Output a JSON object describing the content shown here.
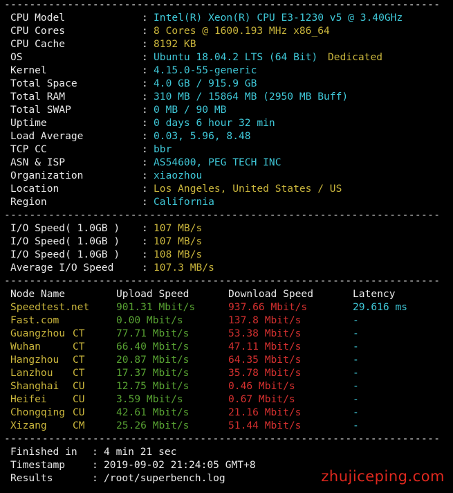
{
  "separator": "--------------------------------------------------------------------------",
  "system": [
    {
      "label": "CPU Model",
      "value": "Intel(R) Xeon(R) CPU E3-1230 v5 @ 3.40GHz",
      "extra": ""
    },
    {
      "label": "CPU Cores",
      "value": "8 Cores @ 1600.193 MHz x86_64",
      "extra": ""
    },
    {
      "label": "CPU Cache",
      "value": "8192 KB",
      "extra": ""
    },
    {
      "label": "OS",
      "value": "Ubuntu 18.04.2 LTS (64 Bit)",
      "extra": "Dedicated"
    },
    {
      "label": "Kernel",
      "value": "4.15.0-55-generic",
      "extra": ""
    },
    {
      "label": "Total Space",
      "value": "4.0 GB / 915.9 GB",
      "extra": ""
    },
    {
      "label": "Total RAM",
      "value": "310 MB / 15864 MB (2950 MB Buff)",
      "extra": ""
    },
    {
      "label": "Total SWAP",
      "value": "0 MB / 90 MB",
      "extra": ""
    },
    {
      "label": "Uptime",
      "value": "0 days 6 hour 32 min",
      "extra": ""
    },
    {
      "label": "Load Average",
      "value": "0.03, 5.96, 8.48",
      "extra": ""
    },
    {
      "label": "TCP CC",
      "value": "bbr",
      "extra": ""
    },
    {
      "label": "ASN & ISP",
      "value": "AS54600, PEG TECH INC",
      "extra": ""
    },
    {
      "label": "Organization",
      "value": "xiaozhou",
      "extra": ""
    },
    {
      "label": "Location",
      "value": "Los Angeles, United States / US",
      "extra": ""
    },
    {
      "label": "Region",
      "value": "California",
      "extra": ""
    }
  ],
  "io": [
    {
      "label": "I/O Speed( 1.0GB )",
      "value": "107 MB/s"
    },
    {
      "label": "I/O Speed( 1.0GB )",
      "value": "107 MB/s"
    },
    {
      "label": "I/O Speed( 1.0GB )",
      "value": "108 MB/s"
    },
    {
      "label": "Average I/O Speed",
      "value": "107.3 MB/s"
    }
  ],
  "speed_header": {
    "node": "Node Name",
    "upload": "Upload Speed",
    "download": "Download Speed",
    "latency": "Latency"
  },
  "speed_rows": [
    {
      "node": "Speedtest.net",
      "isp": "",
      "upload": "901.31 Mbit/s",
      "download": "937.66 Mbit/s",
      "latency": "29.616 ms"
    },
    {
      "node": "Fast.com",
      "isp": "",
      "upload": "0.00 Mbit/s",
      "download": "137.8 Mbit/s",
      "latency": "-"
    },
    {
      "node": "Guangzhou",
      "isp": "CT",
      "upload": "77.71 Mbit/s",
      "download": "53.38 Mbit/s",
      "latency": "-"
    },
    {
      "node": "Wuhan",
      "isp": "CT",
      "upload": "66.40 Mbit/s",
      "download": "47.11 Mbit/s",
      "latency": "-"
    },
    {
      "node": "Hangzhou",
      "isp": "CT",
      "upload": "20.87 Mbit/s",
      "download": "64.35 Mbit/s",
      "latency": "-"
    },
    {
      "node": "Lanzhou",
      "isp": "CT",
      "upload": "17.37 Mbit/s",
      "download": "35.78 Mbit/s",
      "latency": "-"
    },
    {
      "node": "Shanghai",
      "isp": "CU",
      "upload": "12.75 Mbit/s",
      "download": "0.46 Mbit/s",
      "latency": "-"
    },
    {
      "node": "Heifei",
      "isp": "CU",
      "upload": "3.59 Mbit/s",
      "download": "0.67 Mbit/s",
      "latency": "-"
    },
    {
      "node": "Chongqing",
      "isp": "CU",
      "upload": "42.61 Mbit/s",
      "download": "21.16 Mbit/s",
      "latency": "-"
    },
    {
      "node": "Xizang",
      "isp": "CM",
      "upload": "25.26 Mbit/s",
      "download": "51.44 Mbit/s",
      "latency": "-"
    }
  ],
  "summary": [
    {
      "label": "Finished in",
      "value": "4 min 21 sec"
    },
    {
      "label": "Timestamp",
      "value": "2019-09-02 21:24:05 GMT+8"
    },
    {
      "label": "Results",
      "value": "/root/superbench.log"
    }
  ],
  "watermark": "zhujiceping.com",
  "colors": {
    "background": "#000000",
    "value": "#3fc7d7",
    "accent": "#c9b53c",
    "upload": "#57a132",
    "download": "#d4302f"
  }
}
